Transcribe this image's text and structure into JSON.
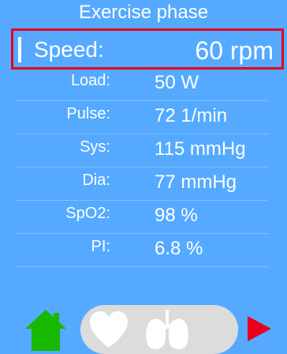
{
  "header": {
    "title": "Exercise phase"
  },
  "speed": {
    "label": "Speed:",
    "value": "60  rpm"
  },
  "metrics": [
    {
      "label": "Load:",
      "value": "50  W"
    },
    {
      "label": "Pulse:",
      "value": "72  1/min"
    },
    {
      "label": "Sys:",
      "value": "115  mmHg"
    },
    {
      "label": "Dia:",
      "value": "77  mmHg"
    },
    {
      "label": "SpO2:",
      "value": "98  %"
    },
    {
      "label": "PI:",
      "value": "6.8  %"
    }
  ],
  "colors": {
    "panel": "#55aaff",
    "highlight_border": "#e8001c",
    "home_icon": "#18b800",
    "play_icon": "#e8001c",
    "button_bg": "#dcdcdc"
  },
  "icons": {
    "home": "home-icon",
    "heart": "heart-icon",
    "lungs": "lungs-icon",
    "play": "play-icon"
  }
}
